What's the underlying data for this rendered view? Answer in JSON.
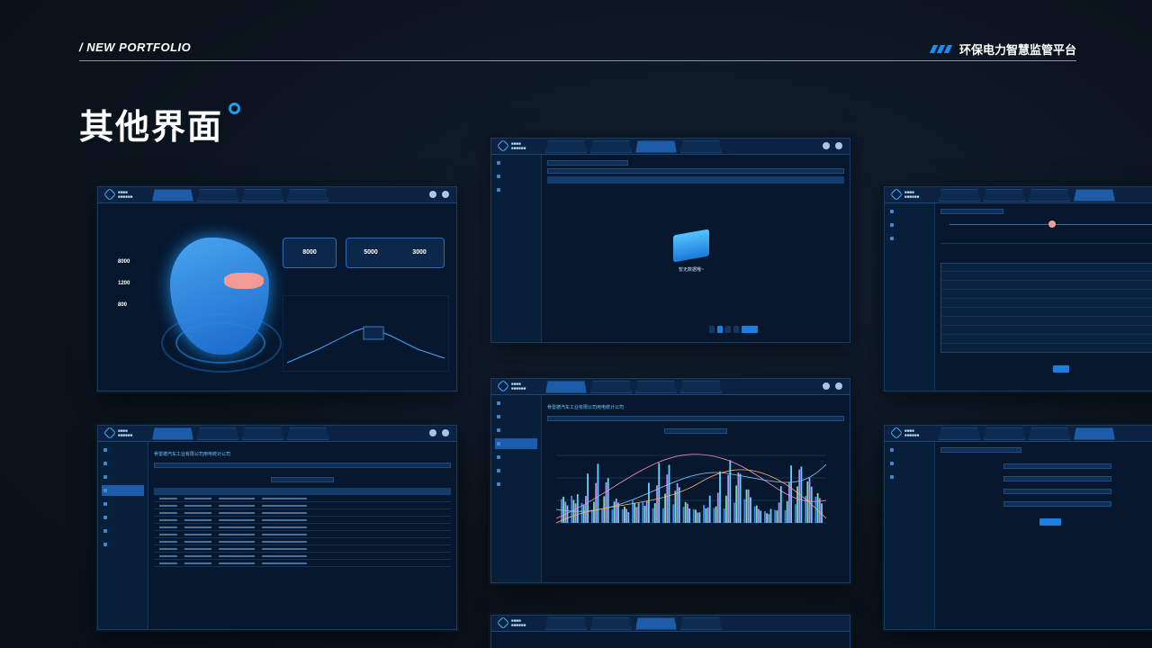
{
  "header": {
    "tag": "/ NEW PORTFOLIO",
    "brand": "环保电力智慧监管平台"
  },
  "page": {
    "title": "其他界面"
  },
  "shots": {
    "dashboard": {
      "kpis": [
        {
          "value": "8000"
        },
        {
          "value": "5000"
        },
        {
          "value": "3000"
        }
      ],
      "stats": [
        {
          "value": "8000"
        },
        {
          "value": "1200"
        },
        {
          "value": "800"
        }
      ]
    },
    "empty": {
      "message": "暂无数据哦~"
    },
    "list": {
      "company": "骨雷德汽车工业有限公司用电统计公司"
    },
    "chart": {
      "company": "骨雷德汽车工业有限公司用电统计公司"
    }
  },
  "colors": {
    "accent": "#1d8cf0",
    "background": "#0a121b",
    "panel": "#07182e"
  }
}
